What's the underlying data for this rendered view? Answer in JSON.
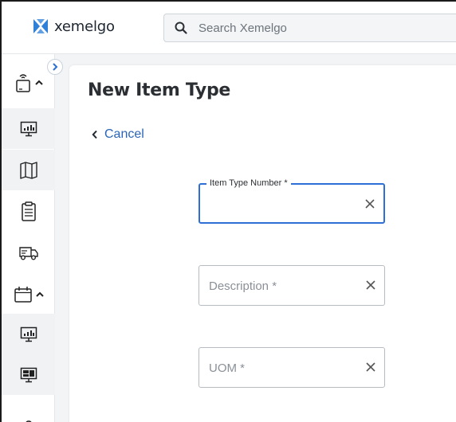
{
  "brand": {
    "name": "xemelgo"
  },
  "search": {
    "placeholder": "Search Xemelgo"
  },
  "sidebar": {
    "items": [
      {
        "icon": "rfid-reader-icon",
        "expandable": true
      },
      {
        "icon": "dashboard-monitor-icon"
      },
      {
        "icon": "map-icon"
      },
      {
        "icon": "clipboard-icon"
      },
      {
        "icon": "delivery-truck-icon"
      },
      {
        "icon": "calendar-icon",
        "expandable": true
      },
      {
        "icon": "dashboard-monitor-icon"
      },
      {
        "icon": "dashboard-grid-icon"
      }
    ]
  },
  "page": {
    "title": "New Item Type",
    "cancel_label": "Cancel"
  },
  "form": {
    "fields": [
      {
        "label": "Item Type Number *",
        "value": "",
        "placeholder": "",
        "focused": true
      },
      {
        "label": "Description *",
        "value": "",
        "placeholder": "Description *",
        "focused": false
      },
      {
        "label": "UOM *",
        "value": "",
        "placeholder": "UOM *",
        "focused": false
      }
    ]
  },
  "colors": {
    "accent": "#2d6fd6",
    "link": "#2a64b8",
    "logo_blue": "#2f80d9"
  }
}
